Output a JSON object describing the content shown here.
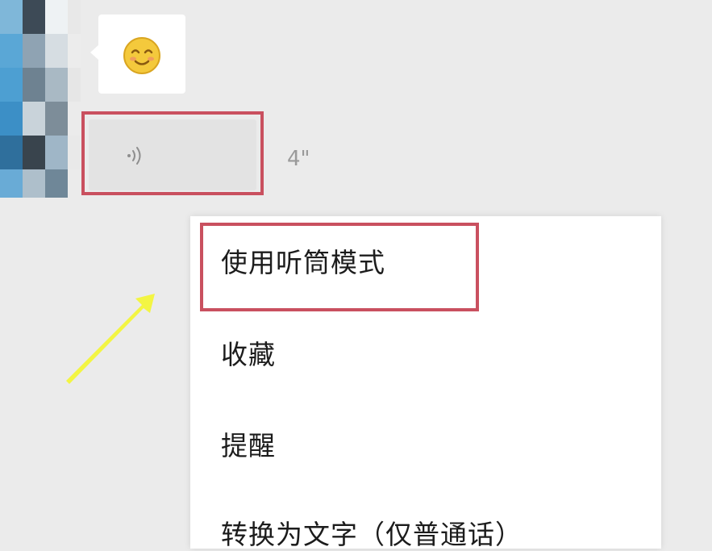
{
  "voice_message": {
    "duration": "4\""
  },
  "context_menu": {
    "items": [
      "使用听筒模式",
      "收藏",
      "提醒",
      "转换为文字（仅普通话）"
    ]
  },
  "colors": {
    "background": "#ebebeb",
    "highlight_border": "#c9505f",
    "annotation_arrow": "#f3f53a",
    "voice_bubble": "#e3e3e3"
  },
  "icons": {
    "avatar": "avatar",
    "emoji": "smiley-emoji-icon",
    "voice": "sound-wave-icon",
    "arrow": "annotation-arrow-icon"
  }
}
